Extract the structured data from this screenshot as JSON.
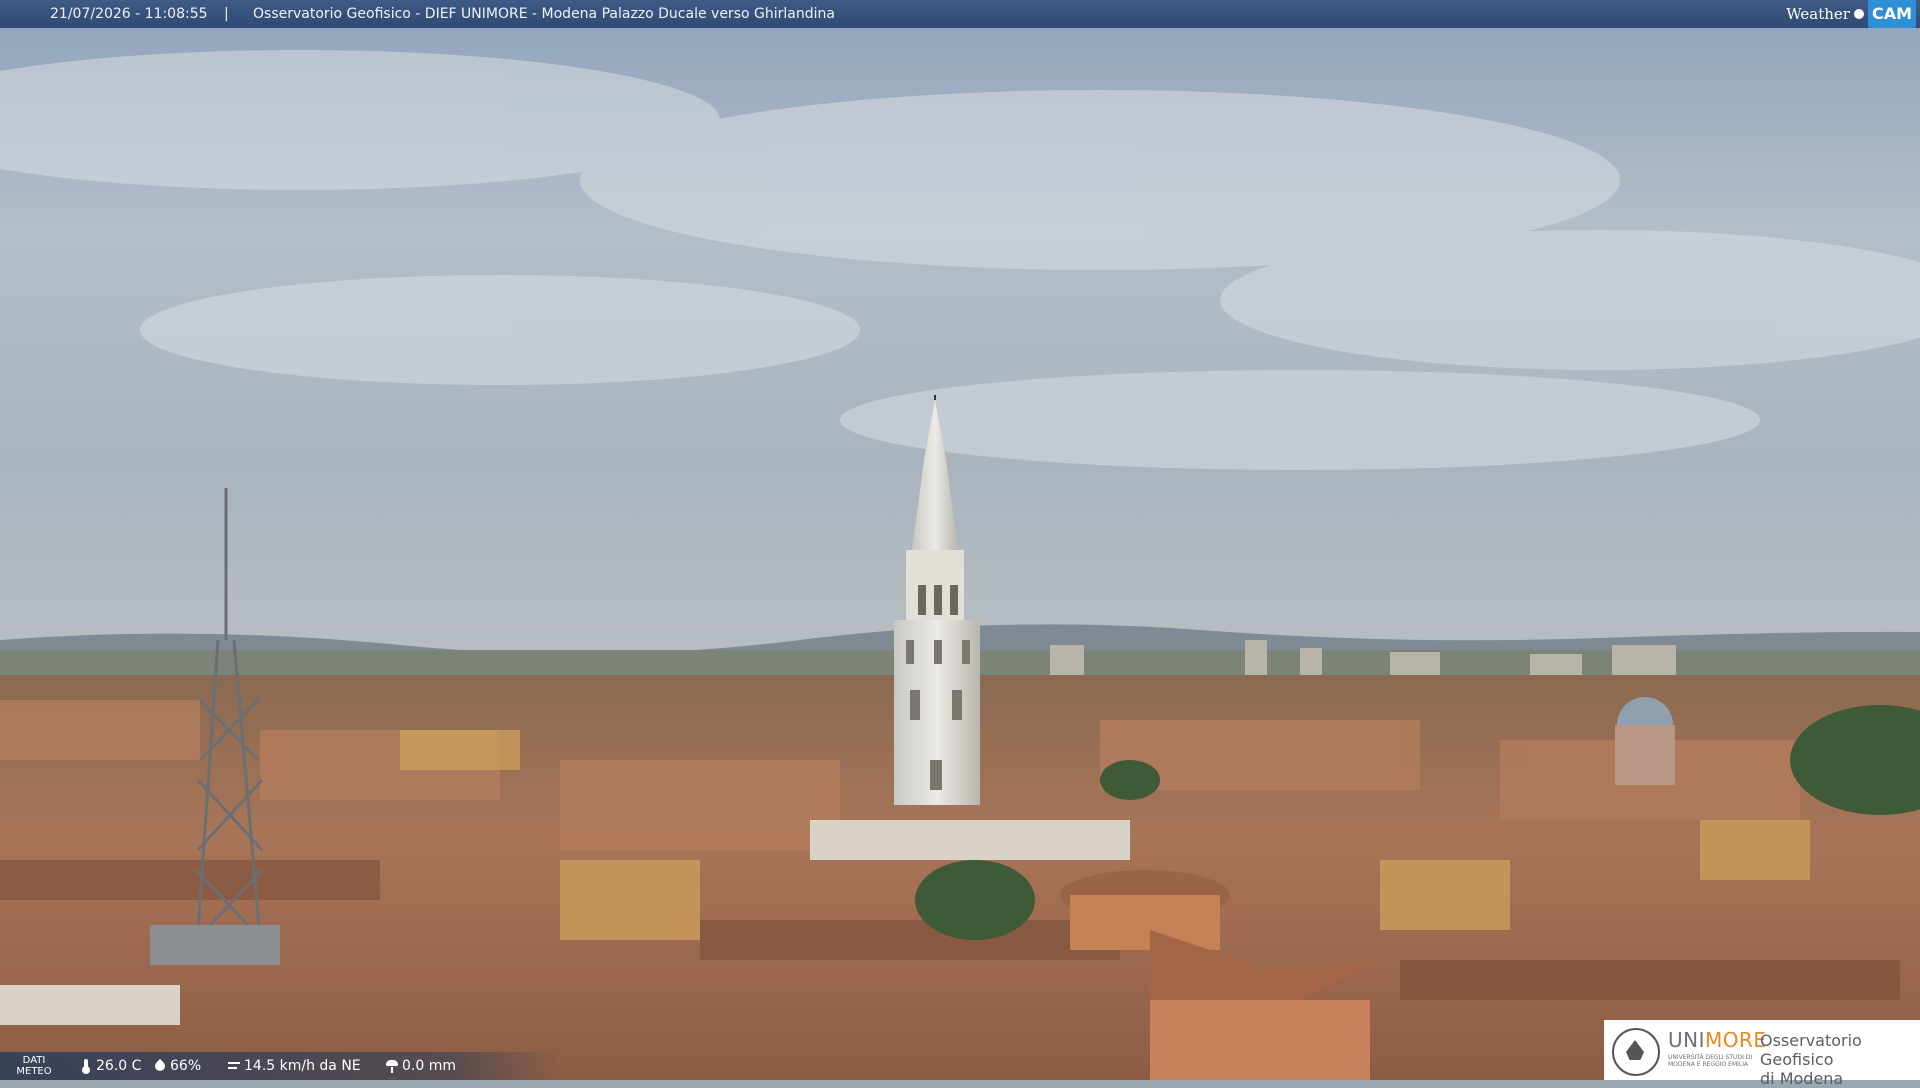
{
  "header": {
    "timestamp": "21/07/2026 - 11:08:55",
    "separator": "|",
    "caption": "Osservatorio Geofisico - DIEF UNIMORE - Modena Palazzo Ducale verso Ghirlandina",
    "brand_weather": "Weather",
    "brand_cam": "CAM"
  },
  "weather": {
    "label_line1": "DATI",
    "label_line2": "METEO",
    "temperature": "26.0 C",
    "humidity": "66%",
    "wind": "14.5 km/h da NE",
    "rain": "0.0 mm",
    "icons": [
      "thermometer-icon",
      "humidity-drop-icon",
      "wind-icon",
      "rain-icon"
    ]
  },
  "logo": {
    "uni_prefix": "UNI",
    "uni_suffix": "MORE",
    "subtitle": "UNIVERSITÀ DEGLI STUDI DI MODENA E REGGIO EMILIA",
    "obs_line1": "Osservatorio Geofisico",
    "obs_line2": "di Modena"
  },
  "colors": {
    "header_bg": "#34507c",
    "brand_cam": "#2d8fd6",
    "unimore_orange": "#e88a22"
  }
}
